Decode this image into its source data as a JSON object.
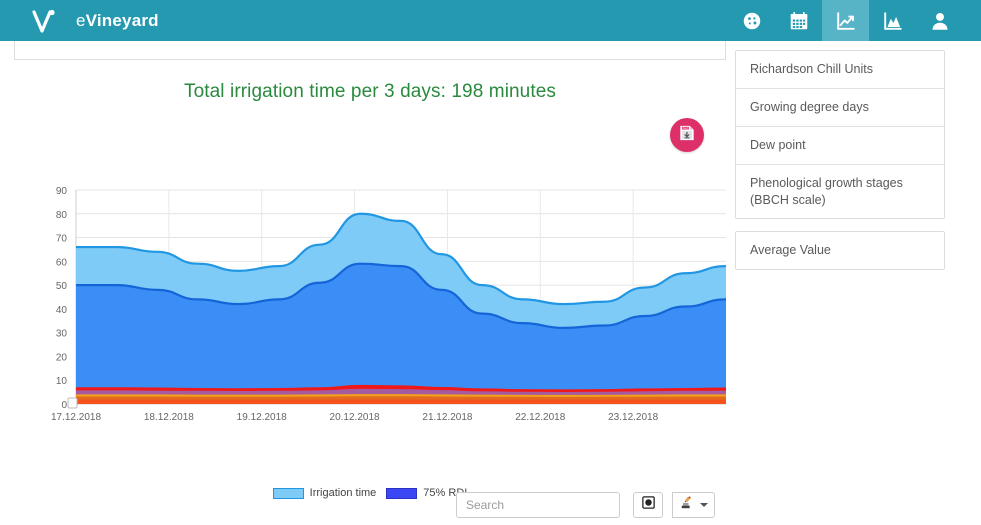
{
  "navbar": {
    "brand_prefix": "e",
    "brand_name": "Vineyard",
    "background_color": "#2499b0",
    "active_color": "#57b4c6",
    "icons": [
      {
        "name": "dashboard-gauge-icon",
        "label": "Dashboard",
        "active": false
      },
      {
        "name": "calendar-icon",
        "label": "Calendar",
        "active": false
      },
      {
        "name": "line-chart-icon",
        "label": "Charts",
        "active": true
      },
      {
        "name": "area-chart-icon",
        "label": "Analytics",
        "active": false
      },
      {
        "name": "user-icon",
        "label": "Account",
        "active": false
      }
    ]
  },
  "chart_panel": {
    "title": "Total irrigation time per 3 days: 198 minutes",
    "title_color": "#2a8a3e",
    "export_button": {
      "label": "PNG",
      "icon": "png-download-icon",
      "color": "#dd3069"
    }
  },
  "chart_data": {
    "type": "area",
    "title": "Total irrigation time per 3 days: 198 minutes",
    "xlabel": "",
    "ylabel": "",
    "ylim": [
      0,
      90
    ],
    "yticks": [
      0,
      10,
      20,
      30,
      40,
      50,
      60,
      70,
      80,
      90
    ],
    "grid": true,
    "legend_position": "bottom",
    "categories": [
      "17.12.2018",
      "18.12.2018",
      "19.12.2018",
      "20.12.2018",
      "21.12.2018",
      "22.12.2018",
      "23.12.2018"
    ],
    "x": [
      0,
      0.5,
      1,
      1.5,
      2,
      2.5,
      3,
      3.5,
      4,
      4.5,
      5,
      5.5,
      6,
      6.5
    ],
    "series": [
      {
        "name": "Irrigation time",
        "color": "#7ecbf7",
        "line_color": "#2196e3",
        "values": [
          66,
          66,
          64,
          59,
          56,
          58,
          67,
          80,
          77,
          63,
          50,
          44,
          42,
          43,
          49,
          55,
          58
        ]
      },
      {
        "name": "75% RDI",
        "color": "#3b8ef5",
        "line_color": "#1565d8",
        "values": [
          50,
          50,
          48,
          44,
          42,
          44,
          51,
          59,
          58,
          48,
          38,
          34,
          32,
          33,
          37,
          41,
          44
        ]
      },
      {
        "name": "red-threshold-line",
        "color": "#f01818",
        "line_color": "#f01818",
        "values": [
          6.5,
          6.5,
          6.4,
          6.2,
          6.1,
          6.2,
          6.5,
          7.5,
          7.3,
          6.6,
          6.0,
          5.7,
          5.6,
          5.7,
          6.0,
          6.2,
          6.4
        ]
      },
      {
        "name": "purple-band",
        "color": "#a55ba0",
        "line_color": "#a55ba0",
        "values": [
          5.2,
          5.2,
          5.1,
          5.0,
          4.9,
          5.0,
          5.2,
          5.8,
          5.7,
          5.3,
          4.8,
          4.6,
          4.5,
          4.6,
          4.8,
          5.0,
          5.1
        ]
      },
      {
        "name": "orange-line",
        "color": "#f5a019",
        "line_color": "#f5a019",
        "values": [
          3.5,
          3.5,
          3.5,
          3.4,
          3.4,
          3.4,
          3.5,
          3.6,
          3.6,
          3.5,
          3.4,
          3.3,
          3.3,
          3.3,
          3.4,
          3.5,
          3.5
        ]
      },
      {
        "name": "dark-orange-band",
        "color": "#e06a1e",
        "line_color": "#e06a1e",
        "values": [
          2.6,
          2.6,
          2.6,
          2.5,
          2.5,
          2.5,
          2.6,
          2.7,
          2.7,
          2.6,
          2.5,
          2.5,
          2.4,
          2.5,
          2.5,
          2.6,
          2.6
        ]
      },
      {
        "name": "bottom-orange-band",
        "color": "#f4521a",
        "line_color": "#f4521a",
        "values": [
          1.3,
          1.3,
          1.3,
          1.3,
          1.3,
          1.3,
          1.3,
          1.3,
          1.3,
          1.3,
          1.3,
          1.3,
          1.3,
          1.3,
          1.3,
          1.3,
          1.3
        ]
      }
    ],
    "legend": [
      {
        "label": "Irrigation time",
        "color": "#7ecbf7"
      },
      {
        "label": "75% RDI",
        "color": "#3b47f5"
      }
    ]
  },
  "sidebar": {
    "groups": [
      {
        "items": [
          {
            "label": "Richardson Chill Units"
          },
          {
            "label": "Growing degree days"
          },
          {
            "label": "Dew point"
          },
          {
            "label": "Phenological growth stages (BBCH scale)"
          }
        ]
      },
      {
        "items": [
          {
            "label": "Average Value"
          }
        ]
      }
    ]
  },
  "bottom_bar": {
    "search_placeholder": "Search",
    "search_value": "",
    "buttons": [
      {
        "name": "target-button",
        "icon": "target-icon"
      },
      {
        "name": "export-data-button",
        "icon": "export-user-icon"
      }
    ]
  }
}
